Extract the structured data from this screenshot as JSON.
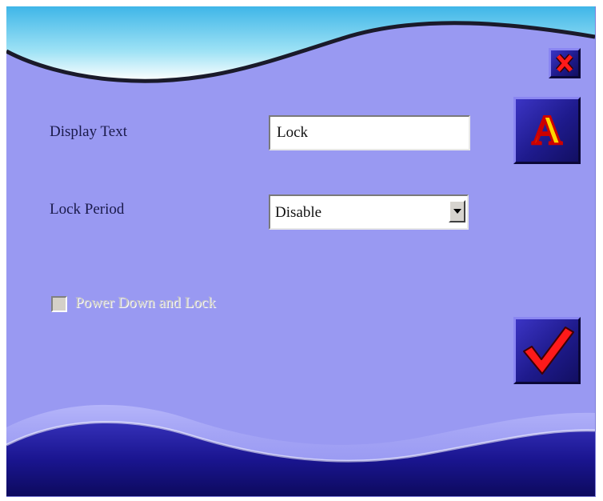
{
  "form": {
    "display_text_label": "Display Text",
    "display_text_value": "Lock",
    "lock_period_label": "Lock Period",
    "lock_period_value": "Disable",
    "power_down_label": "Power Down and Lock",
    "power_down_checked": false,
    "power_down_enabled": false
  },
  "buttons": {
    "close_icon": "close-x-icon",
    "font_icon": "font-a-icon",
    "font_letter": "A",
    "confirm_icon": "checkmark-icon"
  },
  "colors": {
    "dialog_background": "#9999f2",
    "button_face": "#1e1a8c",
    "close_x": "#ff0000",
    "font_letter_fill": "#ffd700",
    "font_letter_outline": "#cc0000",
    "checkmark": "#ff0000"
  }
}
